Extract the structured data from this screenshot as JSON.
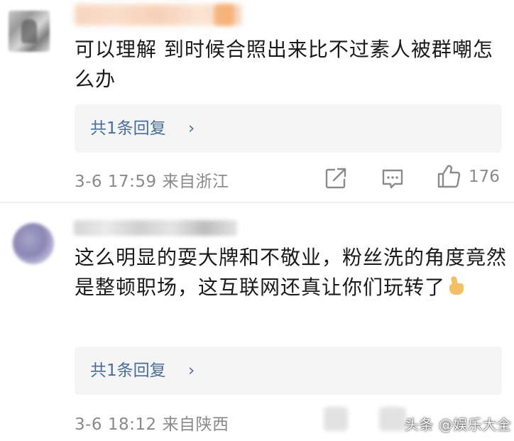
{
  "comments": [
    {
      "text": "可以理解 到时候合照出来比不过素人被群嘲怎么办",
      "reply_label": "共1条回复",
      "reply_chevron": "›",
      "meta": "3-6 17:59  来自浙江",
      "like_count": "176"
    },
    {
      "text": "这么明显的耍大牌和不敬业，粉丝洗的角度竟然是整顿职场，这互联网还真让你们玩转了",
      "reply_label": "共1条回复",
      "reply_chevron": "›",
      "meta": "3-6 18:12  来自陕西"
    }
  ],
  "watermark": "头条 @娱乐大全",
  "colors": {
    "link": "#4a6d9a",
    "meta": "#8a8a8a",
    "reply_bg": "#f5f5f5"
  },
  "icons": [
    "share-icon",
    "comment-icon",
    "thumbs-up-icon",
    "thumbs-up-emoji"
  ]
}
